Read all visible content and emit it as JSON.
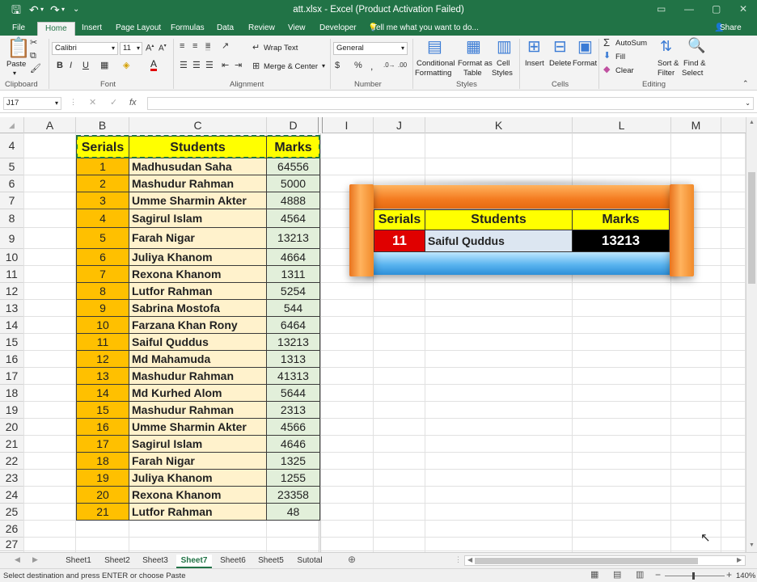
{
  "titlebar": {
    "title": "att.xlsx - Excel (Product Activation Failed)"
  },
  "ribbon_tabs": [
    "File",
    "Home",
    "Insert",
    "Page Layout",
    "Formulas",
    "Data",
    "Review",
    "View",
    "Developer"
  ],
  "tell_me": "Tell me what you want to do...",
  "share": "Share",
  "ribbon": {
    "paste": "Paste",
    "font_name": "Calibri",
    "font_size": "11",
    "wrap_text": "Wrap Text",
    "merge_center": "Merge & Center",
    "number_format": "General",
    "conditional": "Conditional",
    "formatting": "Formatting",
    "format_as": "Format as",
    "table": "Table",
    "cell": "Cell",
    "styles_lbl": "Styles",
    "insert": "Insert",
    "delete": "Delete",
    "format": "Format",
    "autosum": "AutoSum",
    "fill": "Fill",
    "clear": "Clear",
    "sort": "Sort &",
    "filter": "Filter",
    "find": "Find &",
    "select": "Select",
    "groups": [
      "Clipboard",
      "Font",
      "Alignment",
      "Number",
      "Styles",
      "Cells",
      "Editing"
    ]
  },
  "formula_bar": {
    "name_box": "J17",
    "fx": "fx",
    "value": ""
  },
  "columns": [
    "A",
    "B",
    "C",
    "D",
    "I",
    "J",
    "K",
    "L",
    "M"
  ],
  "rows": [
    "4",
    "5",
    "6",
    "7",
    "8",
    "9",
    "10",
    "11",
    "12",
    "13",
    "14",
    "15",
    "16",
    "17",
    "18",
    "19",
    "20",
    "21",
    "22",
    "23",
    "24",
    "25",
    "26",
    "27"
  ],
  "table": {
    "headers": [
      "Serials",
      "Students",
      "Marks"
    ],
    "rows": [
      [
        "1",
        "Madhusudan Saha",
        "64556"
      ],
      [
        "2",
        "Mashudur Rahman",
        "5000"
      ],
      [
        "3",
        "Umme Sharmin Akter",
        "4888"
      ],
      [
        "4",
        "Sagirul Islam",
        "4564"
      ],
      [
        "5",
        "Farah Nigar",
        "13213"
      ],
      [
        "6",
        "Juliya Khanom",
        "4664"
      ],
      [
        "7",
        "Rexona Khanom",
        "1311"
      ],
      [
        "8",
        "Lutfor Rahman",
        "5254"
      ],
      [
        "9",
        "Sabrina Mostofa",
        "544"
      ],
      [
        "10",
        "Farzana Khan Rony",
        "6464"
      ],
      [
        "11",
        "Saiful Quddus",
        "13213"
      ],
      [
        "12",
        "Md Mahamuda",
        "1313"
      ],
      [
        "13",
        "Mashudur Rahman",
        "41313"
      ],
      [
        "14",
        "Md Kurhed Alom",
        "5644"
      ],
      [
        "15",
        "Mashudur Rahman",
        "2313"
      ],
      [
        "16",
        "Umme Sharmin Akter",
        "4566"
      ],
      [
        "17",
        "Sagirul Islam",
        "4646"
      ],
      [
        "18",
        "Farah Nigar",
        "1325"
      ],
      [
        "19",
        "Juliya Khanom",
        "1255"
      ],
      [
        "20",
        "Rexona Khanom",
        "23358"
      ],
      [
        "21",
        "Lutfor Rahman",
        "48"
      ]
    ]
  },
  "lookup": {
    "headers": [
      "Serials",
      "Students",
      "Marks"
    ],
    "serial": "11",
    "student": "Saiful Quddus",
    "marks": "13213"
  },
  "sheets": [
    "Sheet1",
    "Sheet2",
    "Sheet3",
    "Sheet7",
    "Sheet6",
    "Sheet5",
    "Sutotal"
  ],
  "active_sheet": "Sheet7",
  "status": {
    "message": "Select destination and press ENTER or choose Paste",
    "zoom": "140%"
  },
  "colors": {
    "excel_green": "#217346",
    "header_yellow": "#ffff00",
    "serial_orange": "#ffc000",
    "student_cream": "#fff2cc",
    "marks_green": "#e2efda"
  }
}
